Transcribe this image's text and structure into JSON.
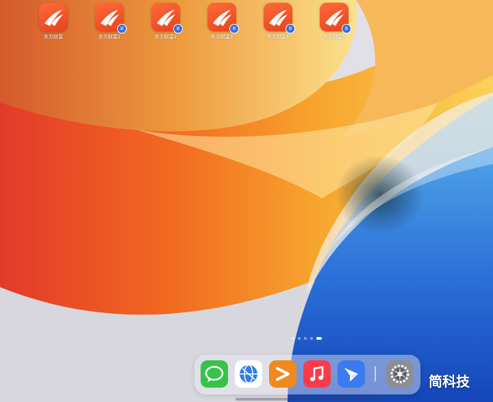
{
  "home_screen": {
    "apps": [
      {
        "label": "东方财富",
        "badge": ""
      },
      {
        "label": "东方财富1",
        "badge": "8"
      },
      {
        "label": "东方财富2",
        "badge": "8"
      },
      {
        "label": "东方财富3",
        "badge": "8"
      },
      {
        "label": "东方财富4",
        "badge": "8"
      },
      {
        "label": "东方财富5",
        "badge": "8"
      }
    ],
    "page_indicator": {
      "pages": 5,
      "current": 5
    }
  },
  "dock": {
    "apps": [
      {
        "name": "messages-app",
        "icon": "speech-bubble-icon",
        "color": "#39c24a"
      },
      {
        "name": "browser-app",
        "icon": "globe-icon",
        "color": "#2f7fe6"
      },
      {
        "name": "infuse-app",
        "icon": "play-arrow-icon",
        "color": "#f08a1e"
      },
      {
        "name": "music-app",
        "icon": "music-note-icon",
        "color": "#fa3b4c"
      },
      {
        "name": "feishu-app",
        "icon": "paper-plane-icon",
        "color": "#3a7bef"
      },
      {
        "name": "settings-app",
        "icon": "gear-icon",
        "color": "#8c8e95"
      }
    ]
  },
  "watermark": {
    "text": "简科技"
  },
  "colors": {
    "app_icon": "#e8431c",
    "badge": "#3a6fd8"
  }
}
